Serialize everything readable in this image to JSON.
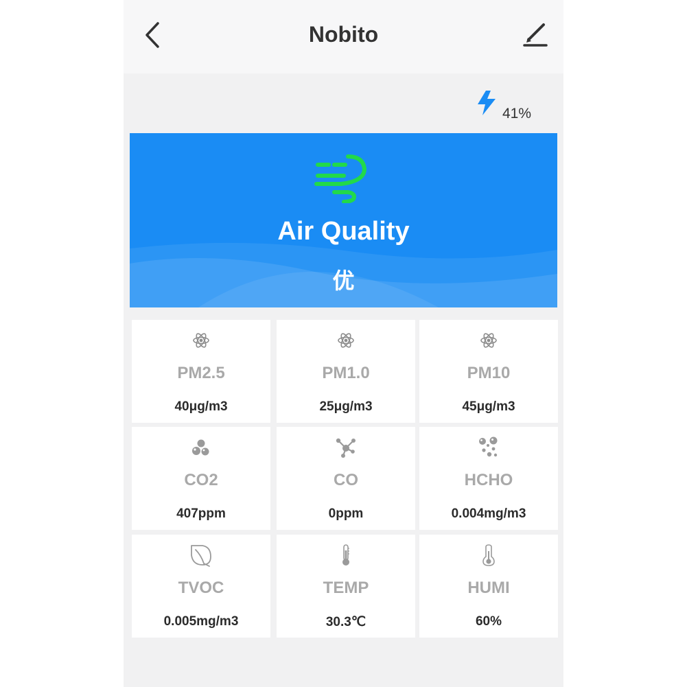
{
  "header": {
    "title": "Nobito",
    "back_icon": "back-chevron-icon",
    "edit_icon": "edit-pencil-icon"
  },
  "battery": {
    "icon": "lightning-icon",
    "level": "41%"
  },
  "banner": {
    "icon": "wind-icon",
    "title": "Air Quality",
    "level": "优",
    "colors": {
      "background": "#1a8cf4",
      "icon": "#22d94a"
    }
  },
  "metrics": [
    {
      "icon": "particle-icon",
      "label": "PM2.5",
      "value": "40μg/m3"
    },
    {
      "icon": "particle-icon",
      "label": "PM1.0",
      "value": "25μg/m3"
    },
    {
      "icon": "particle-icon",
      "label": "PM10",
      "value": "45μg/m3"
    },
    {
      "icon": "bubbles-icon",
      "label": "CO2",
      "value": "407ppm"
    },
    {
      "icon": "molecule-icon",
      "label": "CO",
      "value": "0ppm"
    },
    {
      "icon": "droplets-icon",
      "label": "HCHO",
      "value": "0.004mg/m3"
    },
    {
      "icon": "leaf-icon",
      "label": "TVOC",
      "value": "0.005mg/m3"
    },
    {
      "icon": "thermometer-icon",
      "label": "TEMP",
      "value": "30.3℃"
    },
    {
      "icon": "humidity-thermometer-icon",
      "label": "HUMI",
      "value": "60%"
    }
  ]
}
